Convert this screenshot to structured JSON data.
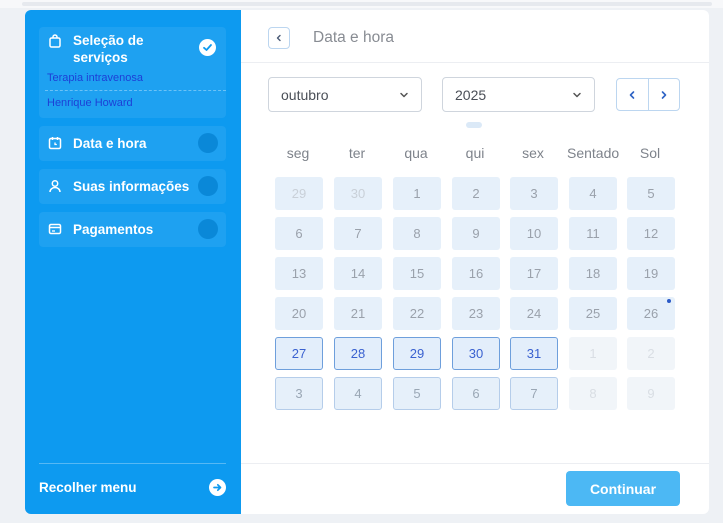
{
  "sidebar": {
    "steps": [
      {
        "label": "Seleção de serviços",
        "icon": "bag-icon",
        "completed": true,
        "details": [
          "Terapia intravenosa",
          "Henrique Howard"
        ]
      },
      {
        "label": "Data e hora",
        "icon": "calendar-clock-icon",
        "completed": false
      },
      {
        "label": "Suas informações",
        "icon": "user-icon",
        "completed": false
      },
      {
        "label": "Pagamentos",
        "icon": "card-icon",
        "completed": false
      }
    ],
    "collapse_label": "Recolher menu"
  },
  "main": {
    "title": "Data e hora",
    "month_select": "outubro",
    "year_select": "2025",
    "weekdays": [
      "seg",
      "ter",
      "qua",
      "qui",
      "sex",
      "Sentado",
      "Sol"
    ],
    "calendar": [
      [
        {
          "d": "29",
          "s": "faint"
        },
        {
          "d": "30",
          "s": "faint"
        },
        {
          "d": "1",
          "s": "disabled"
        },
        {
          "d": "2",
          "s": "disabled"
        },
        {
          "d": "3",
          "s": "disabled"
        },
        {
          "d": "4",
          "s": "disabled"
        },
        {
          "d": "5",
          "s": "disabled"
        }
      ],
      [
        {
          "d": "6",
          "s": "disabled"
        },
        {
          "d": "7",
          "s": "disabled"
        },
        {
          "d": "8",
          "s": "disabled"
        },
        {
          "d": "9",
          "s": "disabled"
        },
        {
          "d": "10",
          "s": "disabled"
        },
        {
          "d": "11",
          "s": "disabled"
        },
        {
          "d": "12",
          "s": "disabled"
        }
      ],
      [
        {
          "d": "13",
          "s": "disabled"
        },
        {
          "d": "14",
          "s": "disabled"
        },
        {
          "d": "15",
          "s": "disabled"
        },
        {
          "d": "16",
          "s": "disabled"
        },
        {
          "d": "17",
          "s": "disabled"
        },
        {
          "d": "18",
          "s": "disabled"
        },
        {
          "d": "19",
          "s": "disabled"
        }
      ],
      [
        {
          "d": "20",
          "s": "disabled"
        },
        {
          "d": "21",
          "s": "disabled"
        },
        {
          "d": "22",
          "s": "disabled"
        },
        {
          "d": "23",
          "s": "disabled"
        },
        {
          "d": "24",
          "s": "disabled"
        },
        {
          "d": "25",
          "s": "disabled"
        },
        {
          "d": "26",
          "s": "disabled",
          "dot": true
        }
      ],
      [
        {
          "d": "27",
          "s": "active"
        },
        {
          "d": "28",
          "s": "active"
        },
        {
          "d": "29",
          "s": "active"
        },
        {
          "d": "30",
          "s": "active"
        },
        {
          "d": "31",
          "s": "active"
        },
        {
          "d": "1",
          "s": "empty"
        },
        {
          "d": "2",
          "s": "empty"
        }
      ],
      [
        {
          "d": "3",
          "s": "next"
        },
        {
          "d": "4",
          "s": "next"
        },
        {
          "d": "5",
          "s": "next"
        },
        {
          "d": "6",
          "s": "next"
        },
        {
          "d": "7",
          "s": "next"
        },
        {
          "d": "8",
          "s": "empty"
        },
        {
          "d": "9",
          "s": "empty"
        }
      ]
    ],
    "continue_label": "Continuar"
  },
  "colors": {
    "sidebar": "#0d9af0",
    "accent": "#3a61d0",
    "button": "#4cb8f4"
  }
}
